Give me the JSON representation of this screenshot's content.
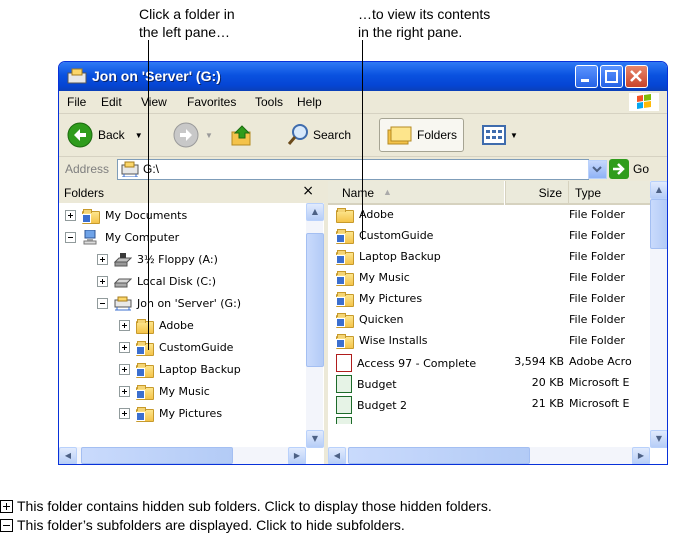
{
  "callouts": {
    "left": [
      "Click a folder in",
      "the left pane…"
    ],
    "right": [
      "…to view its contents",
      "in the right pane."
    ]
  },
  "window": {
    "title": "Jon on 'Server' (G:)",
    "menu": [
      "File",
      "Edit",
      "View",
      "Favorites",
      "Tools",
      "Help"
    ],
    "toolbar": {
      "back": "Back",
      "search": "Search",
      "folders": "Folders"
    },
    "address": {
      "label": "Address",
      "value": "G:\\",
      "go": "Go"
    }
  },
  "folders_pane": {
    "title": "Folders",
    "close": "×",
    "items": [
      {
        "label": "My Documents",
        "toggle": "plus"
      },
      {
        "label": "My Computer",
        "toggle": "minus"
      },
      {
        "label": "3½ Floppy (A:)",
        "toggle": "plus"
      },
      {
        "label": "Local Disk (C:)",
        "toggle": "plus"
      },
      {
        "label": "Jon on 'Server' (G:)",
        "toggle": "minus"
      },
      {
        "label": "Adobe",
        "toggle": "plus"
      },
      {
        "label": "CustomGuide",
        "toggle": "plus"
      },
      {
        "label": "Laptop Backup",
        "toggle": "plus"
      },
      {
        "label": "My Music",
        "toggle": "plus"
      },
      {
        "label": "My Pictures",
        "toggle": "plus"
      }
    ]
  },
  "list_pane": {
    "columns": {
      "name": "Name",
      "size": "Size",
      "type": "Type"
    },
    "rows": [
      {
        "name": "Adobe",
        "size": "",
        "type": "File Folder"
      },
      {
        "name": "CustomGuide",
        "size": "",
        "type": "File Folder"
      },
      {
        "name": "Laptop Backup",
        "size": "",
        "type": "File Folder"
      },
      {
        "name": "My Music",
        "size": "",
        "type": "File Folder"
      },
      {
        "name": "My Pictures",
        "size": "",
        "type": "File Folder"
      },
      {
        "name": "Quicken",
        "size": "",
        "type": "File Folder"
      },
      {
        "name": "Wise Installs",
        "size": "",
        "type": "File Folder"
      },
      {
        "name": "Access 97 - Complete",
        "size": "3,594 KB",
        "type": "Adobe Acro"
      },
      {
        "name": "Budget",
        "size": "20 KB",
        "type": "Microsoft E"
      },
      {
        "name": "Budget 2",
        "size": "21 KB",
        "type": "Microsoft E"
      }
    ]
  },
  "legend": {
    "plus": "This folder contains hidden sub folders. Click to display those hidden folders.",
    "minus": "This folder’s subfolders are displayed. Click to hide subfolders."
  }
}
